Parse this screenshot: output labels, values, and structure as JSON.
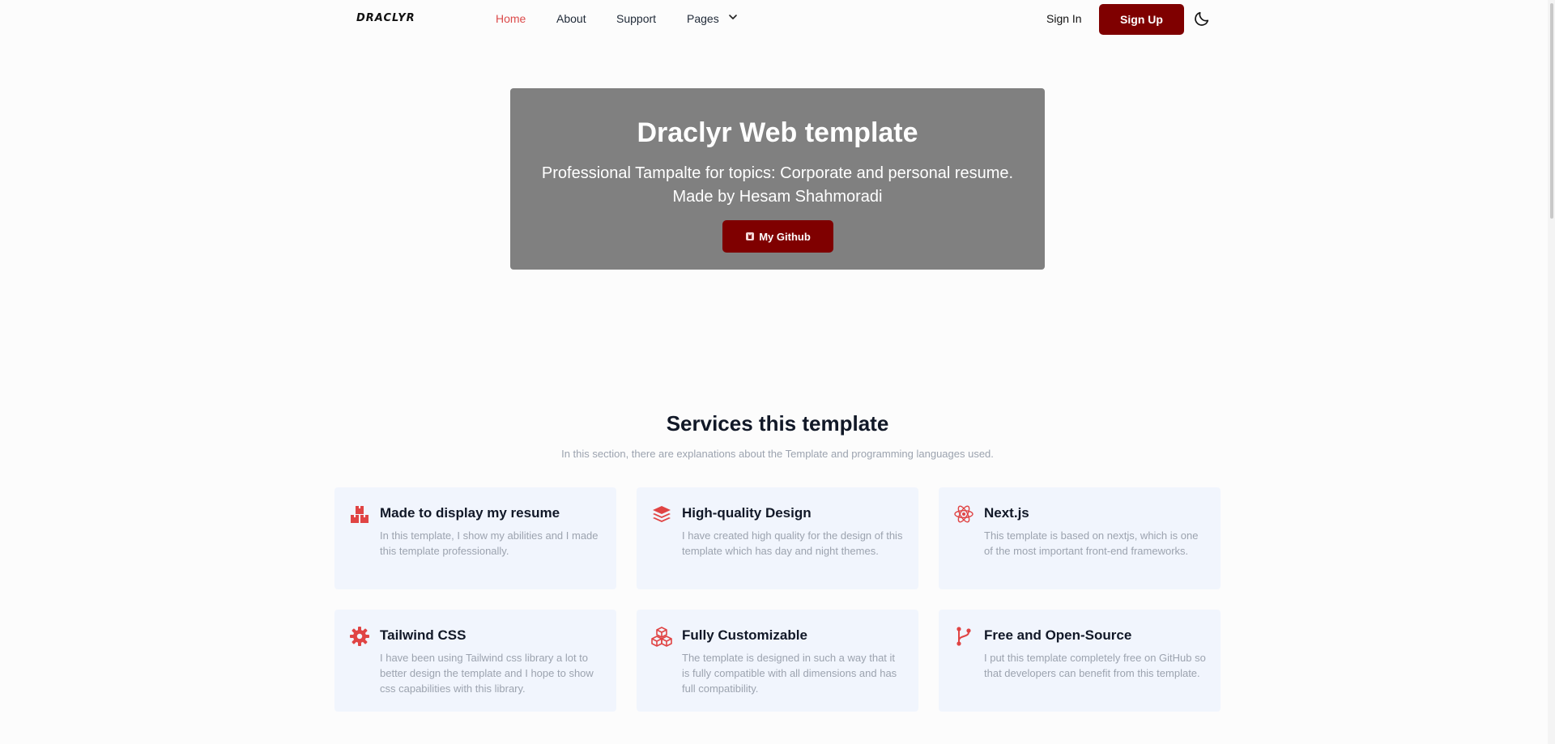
{
  "nav": {
    "logo": "DRACLYR",
    "links": [
      {
        "label": "Home"
      },
      {
        "label": "About"
      },
      {
        "label": "Support"
      },
      {
        "label": "Pages"
      }
    ],
    "signin_label": "Sign In",
    "signup_label": "Sign Up"
  },
  "hero": {
    "title": "Draclyr Web template",
    "subtitle_line1": "Professional Tampalte for topics: Corporate and personal resume.",
    "subtitle_line2": "Made by Hesam Shahmoradi",
    "button_label": "My Github"
  },
  "services": {
    "title": "Services this template",
    "subtitle": "In this section, there are explanations about the Template and programming languages used.",
    "cards": [
      {
        "icon": "boxes-icon",
        "title": "Made to display my resume",
        "description": "In this template, I show my abilities and I made this template professionally."
      },
      {
        "icon": "layers-icon",
        "title": "High-quality Design",
        "description": "I have created high quality for the design of this template which has day and night themes."
      },
      {
        "icon": "react-icon",
        "title": "Next.js",
        "description": "This template is based on nextjs, which is one of the most important front-end frameworks."
      },
      {
        "icon": "gear-icon",
        "title": "Tailwind CSS",
        "description": "I have been using Tailwind css library a lot to better design the template and I hope to show css capabilities with this library."
      },
      {
        "icon": "cubes-icon",
        "title": "Fully Customizable",
        "description": "The template is designed in such a way that it is fully compatible with all dimensions and has full compatibility."
      },
      {
        "icon": "git-branch-icon",
        "title": "Free and Open-Source",
        "description": "I put this template completely free on GitHub so that developers can benefit from this template."
      }
    ]
  },
  "colors": {
    "accent": "#7f0000",
    "active_link": "#dc4b4b",
    "icon": "#e04444",
    "hero_bg": "#808080",
    "card_bg": "#f1f5fd"
  }
}
